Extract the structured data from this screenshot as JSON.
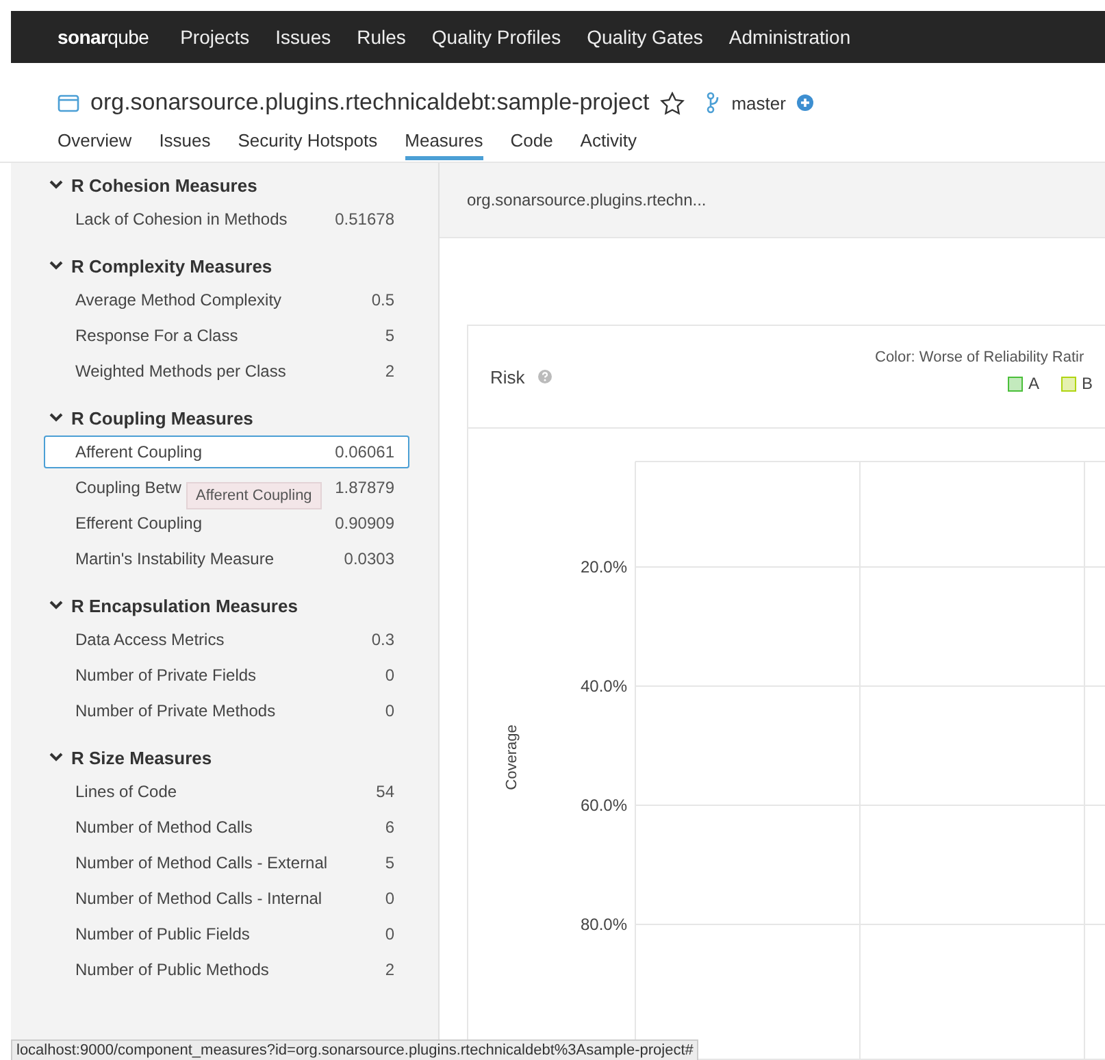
{
  "navbar": {
    "logo": {
      "prefix": "sonar",
      "suffix": "qube"
    },
    "items": [
      "Projects",
      "Issues",
      "Rules",
      "Quality Profiles",
      "Quality Gates",
      "Administration"
    ]
  },
  "project": {
    "name": "org.sonarsource.plugins.rtechnicaldebt:sample-project",
    "favorite": false,
    "branch": "master"
  },
  "tabs": [
    {
      "label": "Overview",
      "selected": false
    },
    {
      "label": "Issues",
      "selected": false
    },
    {
      "label": "Security Hotspots",
      "selected": false
    },
    {
      "label": "Measures",
      "selected": true
    },
    {
      "label": "Code",
      "selected": false
    },
    {
      "label": "Activity",
      "selected": false
    }
  ],
  "sidebar": {
    "groups": [
      {
        "title": "R Cohesion Measures",
        "expanded": true,
        "items": [
          {
            "label": "Lack of Cohesion in Methods",
            "value": "0.51678",
            "selected": false
          }
        ]
      },
      {
        "title": "R Complexity Measures",
        "expanded": true,
        "items": [
          {
            "label": "Average Method Complexity",
            "value": "0.5",
            "selected": false
          },
          {
            "label": "Response For a Class",
            "value": "5",
            "selected": false
          },
          {
            "label": "Weighted Methods per Class",
            "value": "2",
            "selected": false
          }
        ]
      },
      {
        "title": "R Coupling Measures",
        "expanded": true,
        "items": [
          {
            "label": "Afferent Coupling",
            "value": "0.06061",
            "selected": true,
            "tooltip": "Afferent Coupling"
          },
          {
            "label": "Coupling Betw",
            "value": "1.87879",
            "selected": false
          },
          {
            "label": "Efferent Coupling",
            "value": "0.90909",
            "selected": false
          },
          {
            "label": "Martin's Instability Measure",
            "value": "0.0303",
            "selected": false
          }
        ]
      },
      {
        "title": "R Encapsulation Measures",
        "expanded": true,
        "items": [
          {
            "label": "Data Access Metrics",
            "value": "0.3",
            "selected": false
          },
          {
            "label": "Number of Private Fields",
            "value": "0",
            "selected": false
          },
          {
            "label": "Number of Private Methods",
            "value": "0",
            "selected": false
          }
        ]
      },
      {
        "title": "R Size Measures",
        "expanded": true,
        "items": [
          {
            "label": "Lines of Code",
            "value": "54",
            "selected": false
          },
          {
            "label": "Number of Method Calls",
            "value": "6",
            "selected": false
          },
          {
            "label": "Number of Method Calls - External",
            "value": "5",
            "selected": false
          },
          {
            "label": "Number of Method Calls - Internal",
            "value": "0",
            "selected": false
          },
          {
            "label": "Number of Public Fields",
            "value": "0",
            "selected": false
          },
          {
            "label": "Number of Public Methods",
            "value": "2",
            "selected": false
          }
        ]
      }
    ]
  },
  "breadcrumb": "org.sonarsource.plugins.rtechn...",
  "risk": {
    "title": "Risk",
    "color_caption": "Color: Worse of Reliability Ratir",
    "legend": [
      {
        "label": "A",
        "color": "#4bbf3a"
      },
      {
        "label": "B",
        "color": "#b0d513"
      }
    ],
    "y_axis": {
      "label": "Coverage",
      "ticks": [
        "20.0%",
        "40.0%",
        "60.0%",
        "80.0%"
      ]
    }
  },
  "status_url": "localhost:9000/component_measures?id=org.sonarsource.plugins.rtechnicaldebt%3Asample-project#"
}
